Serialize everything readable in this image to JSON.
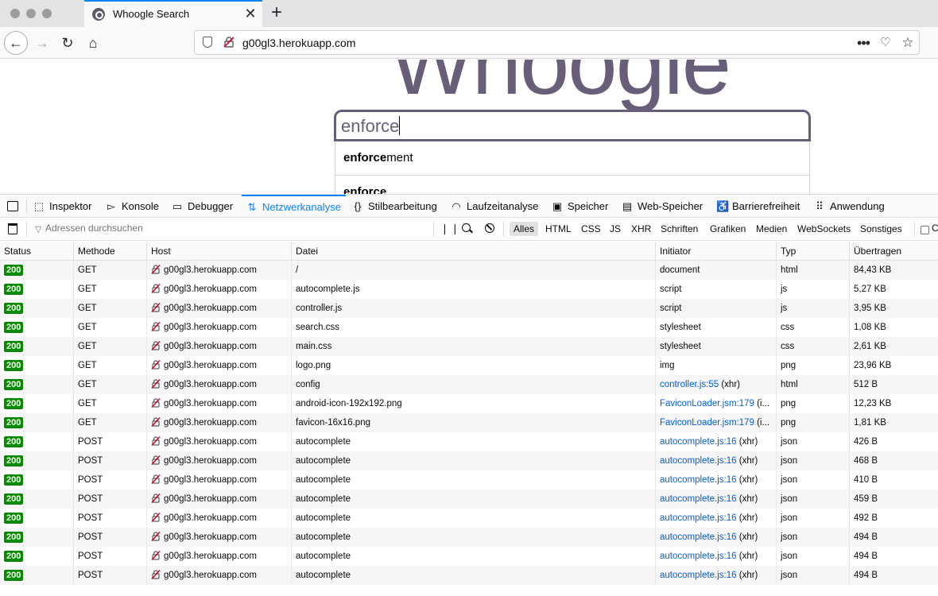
{
  "browser": {
    "tab_title": "Whoogle Search",
    "tab_close": "✕",
    "new_tab": "+",
    "url": "g00gl3.herokuapp.com"
  },
  "page": {
    "logo": "Whoogle",
    "search_value": "enforce",
    "suggestions": [
      {
        "bold": "enforce",
        "rest": "ment"
      },
      {
        "bold": "enforce",
        "rest": ""
      }
    ]
  },
  "devtools": {
    "tabs": [
      {
        "label": "Inspektor",
        "icon": "inspector-icon"
      },
      {
        "label": "Konsole",
        "icon": "console-icon"
      },
      {
        "label": "Debugger",
        "icon": "debugger-icon"
      },
      {
        "label": "Netzwerkanalyse",
        "icon": "network-icon",
        "active": true
      },
      {
        "label": "Stilbearbeitung",
        "icon": "style-editor-icon"
      },
      {
        "label": "Laufzeitanalyse",
        "icon": "performance-icon"
      },
      {
        "label": "Speicher",
        "icon": "memory-icon"
      },
      {
        "label": "Web-Speicher",
        "icon": "storage-icon"
      },
      {
        "label": "Barrierefreiheit",
        "icon": "accessibility-icon"
      },
      {
        "label": "Anwendung",
        "icon": "application-icon"
      }
    ],
    "filter_placeholder": "Adressen durchsuchen",
    "type_filters": [
      "Alles",
      "HTML",
      "CSS",
      "JS",
      "XHR",
      "Schriften",
      "Grafiken",
      "Medien",
      "WebSockets",
      "Sonstiges"
    ],
    "active_type_filter": "Alles",
    "persist_label": "C"
  },
  "network": {
    "columns": [
      "Status",
      "Methode",
      "Host",
      "Datei",
      "Initiator",
      "Typ",
      "Übertragen"
    ],
    "rows": [
      {
        "status": "200",
        "method": "GET",
        "host": "g00gl3.herokuapp.com",
        "file": "/",
        "initiator": "document",
        "initiator_link": "",
        "initiator_suffix": "",
        "type": "html",
        "size": "84,43 KB"
      },
      {
        "status": "200",
        "method": "GET",
        "host": "g00gl3.herokuapp.com",
        "file": "autocomplete.js",
        "initiator": "script",
        "initiator_link": "",
        "initiator_suffix": "",
        "type": "js",
        "size": "5,27 KB"
      },
      {
        "status": "200",
        "method": "GET",
        "host": "g00gl3.herokuapp.com",
        "file": "controller.js",
        "initiator": "script",
        "initiator_link": "",
        "initiator_suffix": "",
        "type": "js",
        "size": "3,95 KB"
      },
      {
        "status": "200",
        "method": "GET",
        "host": "g00gl3.herokuapp.com",
        "file": "search.css",
        "initiator": "stylesheet",
        "initiator_link": "",
        "initiator_suffix": "",
        "type": "css",
        "size": "1,08 KB"
      },
      {
        "status": "200",
        "method": "GET",
        "host": "g00gl3.herokuapp.com",
        "file": "main.css",
        "initiator": "stylesheet",
        "initiator_link": "",
        "initiator_suffix": "",
        "type": "css",
        "size": "2,61 KB"
      },
      {
        "status": "200",
        "method": "GET",
        "host": "g00gl3.herokuapp.com",
        "file": "logo.png",
        "initiator": "img",
        "initiator_link": "",
        "initiator_suffix": "",
        "type": "png",
        "size": "23,96 KB"
      },
      {
        "status": "200",
        "method": "GET",
        "host": "g00gl3.herokuapp.com",
        "file": "config",
        "initiator": "",
        "initiator_link": "controller.js:55",
        "initiator_suffix": " (xhr)",
        "type": "html",
        "size": "512 B"
      },
      {
        "status": "200",
        "method": "GET",
        "host": "g00gl3.herokuapp.com",
        "file": "android-icon-192x192.png",
        "initiator": "",
        "initiator_link": "FaviconLoader.jsm:179",
        "initiator_suffix": " (i...",
        "type": "png",
        "size": "12,23 KB"
      },
      {
        "status": "200",
        "method": "GET",
        "host": "g00gl3.herokuapp.com",
        "file": "favicon-16x16.png",
        "initiator": "",
        "initiator_link": "FaviconLoader.jsm:179",
        "initiator_suffix": " (i...",
        "type": "png",
        "size": "1,81 KB"
      },
      {
        "status": "200",
        "method": "POST",
        "host": "g00gl3.herokuapp.com",
        "file": "autocomplete",
        "initiator": "",
        "initiator_link": "autocomplete.js:16",
        "initiator_suffix": " (xhr)",
        "type": "json",
        "size": "426 B"
      },
      {
        "status": "200",
        "method": "POST",
        "host": "g00gl3.herokuapp.com",
        "file": "autocomplete",
        "initiator": "",
        "initiator_link": "autocomplete.js:16",
        "initiator_suffix": " (xhr)",
        "type": "json",
        "size": "468 B"
      },
      {
        "status": "200",
        "method": "POST",
        "host": "g00gl3.herokuapp.com",
        "file": "autocomplete",
        "initiator": "",
        "initiator_link": "autocomplete.js:16",
        "initiator_suffix": " (xhr)",
        "type": "json",
        "size": "410 B"
      },
      {
        "status": "200",
        "method": "POST",
        "host": "g00gl3.herokuapp.com",
        "file": "autocomplete",
        "initiator": "",
        "initiator_link": "autocomplete.js:16",
        "initiator_suffix": " (xhr)",
        "type": "json",
        "size": "459 B"
      },
      {
        "status": "200",
        "method": "POST",
        "host": "g00gl3.herokuapp.com",
        "file": "autocomplete",
        "initiator": "",
        "initiator_link": "autocomplete.js:16",
        "initiator_suffix": " (xhr)",
        "type": "json",
        "size": "492 B"
      },
      {
        "status": "200",
        "method": "POST",
        "host": "g00gl3.herokuapp.com",
        "file": "autocomplete",
        "initiator": "",
        "initiator_link": "autocomplete.js:16",
        "initiator_suffix": " (xhr)",
        "type": "json",
        "size": "494 B"
      },
      {
        "status": "200",
        "method": "POST",
        "host": "g00gl3.herokuapp.com",
        "file": "autocomplete",
        "initiator": "",
        "initiator_link": "autocomplete.js:16",
        "initiator_suffix": " (xhr)",
        "type": "json",
        "size": "494 B"
      },
      {
        "status": "200",
        "method": "POST",
        "host": "g00gl3.herokuapp.com",
        "file": "autocomplete",
        "initiator": "",
        "initiator_link": "autocomplete.js:16",
        "initiator_suffix": " (xhr)",
        "type": "json",
        "size": "494 B"
      }
    ]
  },
  "colors": {
    "accent": "#0a84ff",
    "logo": "#685e79",
    "status_ok": "#058b00",
    "link": "#0060df"
  }
}
